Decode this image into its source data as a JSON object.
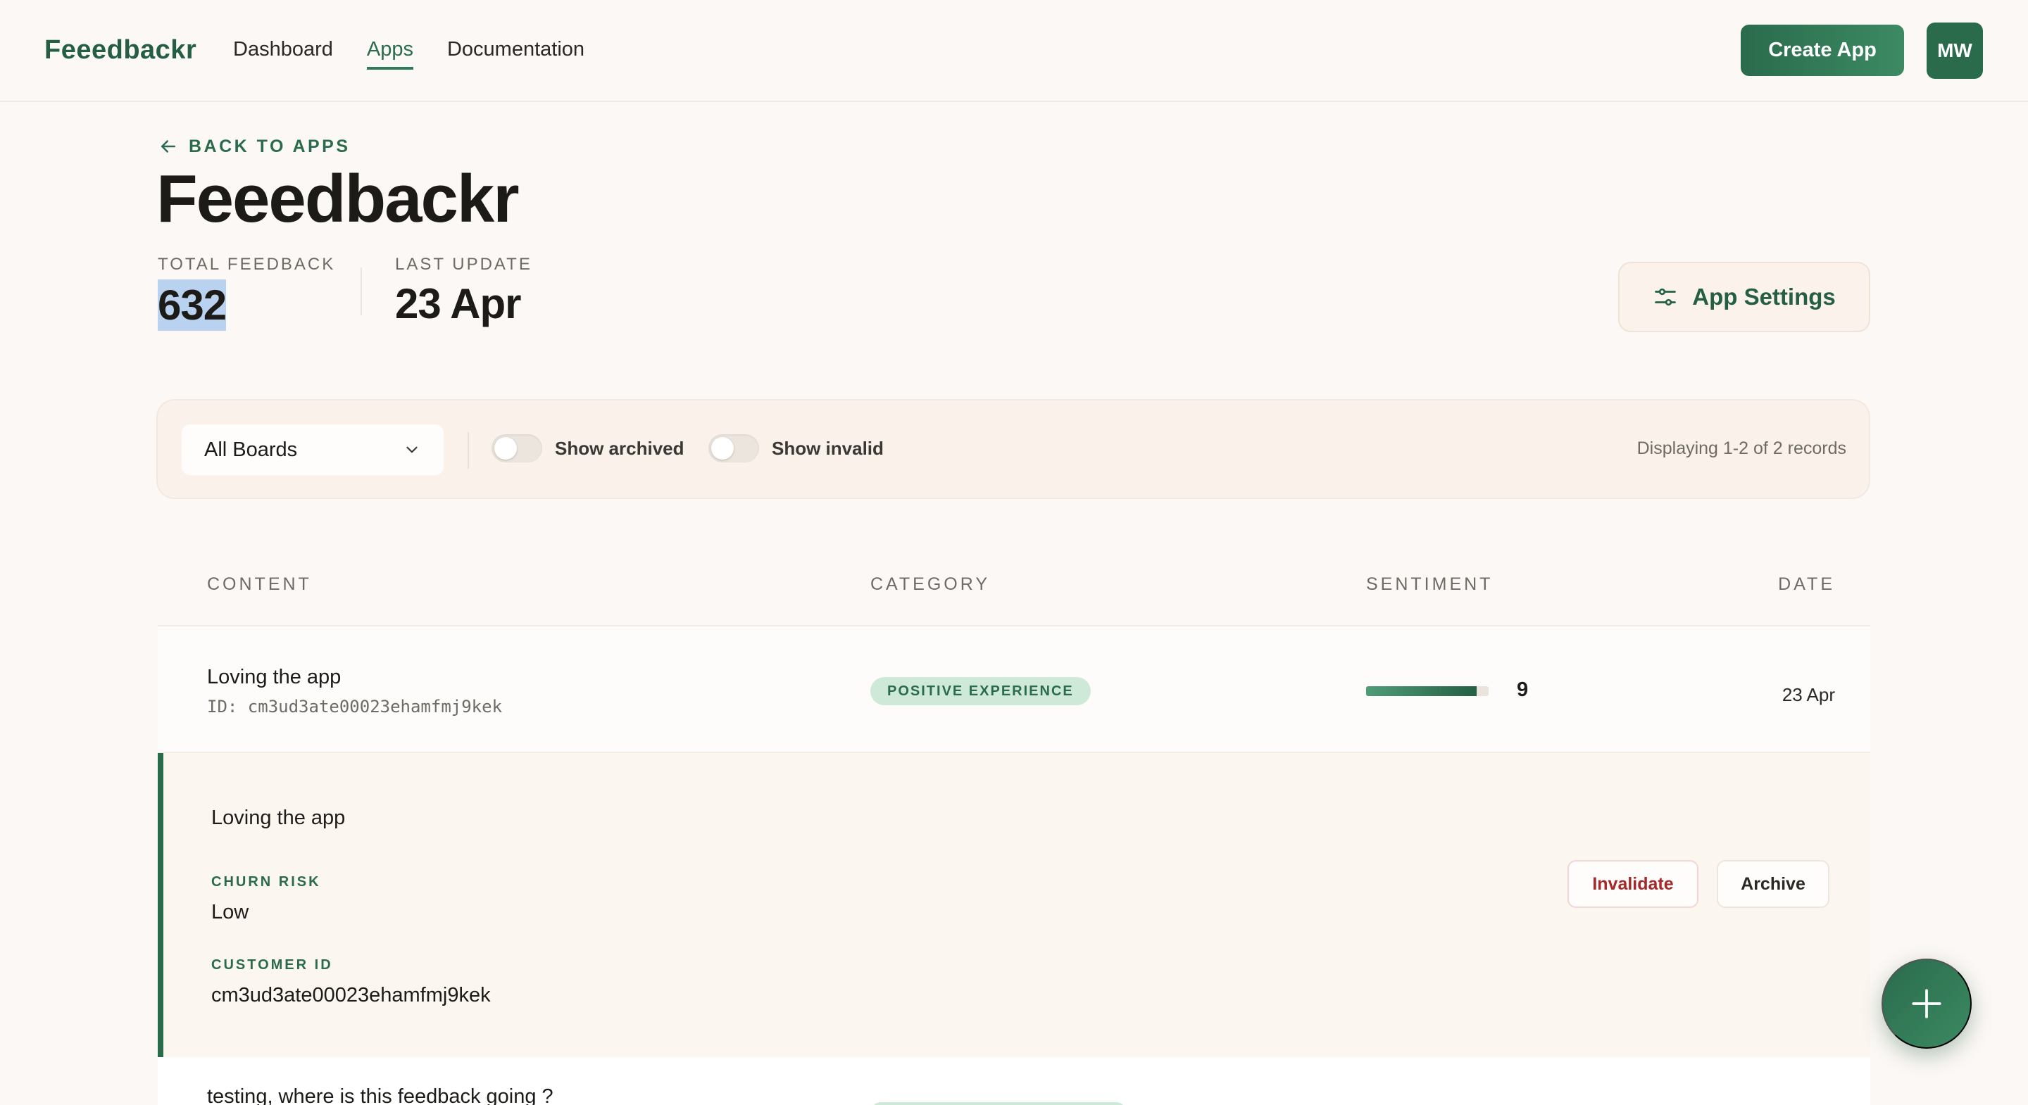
{
  "header": {
    "logo": "Feeedbackr",
    "nav": [
      {
        "label": "Dashboard",
        "active": false
      },
      {
        "label": "Apps",
        "active": true
      },
      {
        "label": "Documentation",
        "active": false
      }
    ],
    "create_label": "Create App",
    "avatar_initials": "MW"
  },
  "page": {
    "back_label": "BACK TO APPS",
    "title": "Feeedbackr",
    "stats": {
      "total_label": "TOTAL FEEDBACK",
      "total_value": "632",
      "last_update_label": "LAST UPDATE",
      "last_update_value": "23 Apr"
    },
    "settings_label": "App Settings"
  },
  "filters": {
    "board_select": "All Boards",
    "show_archived": "Show archived",
    "show_invalid": "Show invalid",
    "records_text": "Displaying 1-2 of 2 records"
  },
  "table": {
    "columns": [
      "CONTENT",
      "CATEGORY",
      "SENTIMENT",
      "DATE"
    ],
    "rows": [
      {
        "title": "Loving the app",
        "id_text": "ID: cm3ud3ate00023ehamfmj9kek",
        "category": "POSITIVE EXPERIENCE",
        "sentiment": "9",
        "sentiment_fraction": 0.9,
        "date": "23 Apr"
      },
      {
        "title": "testing, where is this feedback going ?"
      }
    ],
    "detail": {
      "title": "Loving the app",
      "churn_label": "CHURN RISK",
      "churn_value": "Low",
      "customer_label": "CUSTOMER ID",
      "customer_value": "cm3ud3ate00023ehamfmj9kek",
      "invalidate_label": "Invalidate",
      "archive_label": "Archive"
    }
  },
  "colors": {
    "brand": "#2a6b4c",
    "danger": "#a3292b"
  }
}
